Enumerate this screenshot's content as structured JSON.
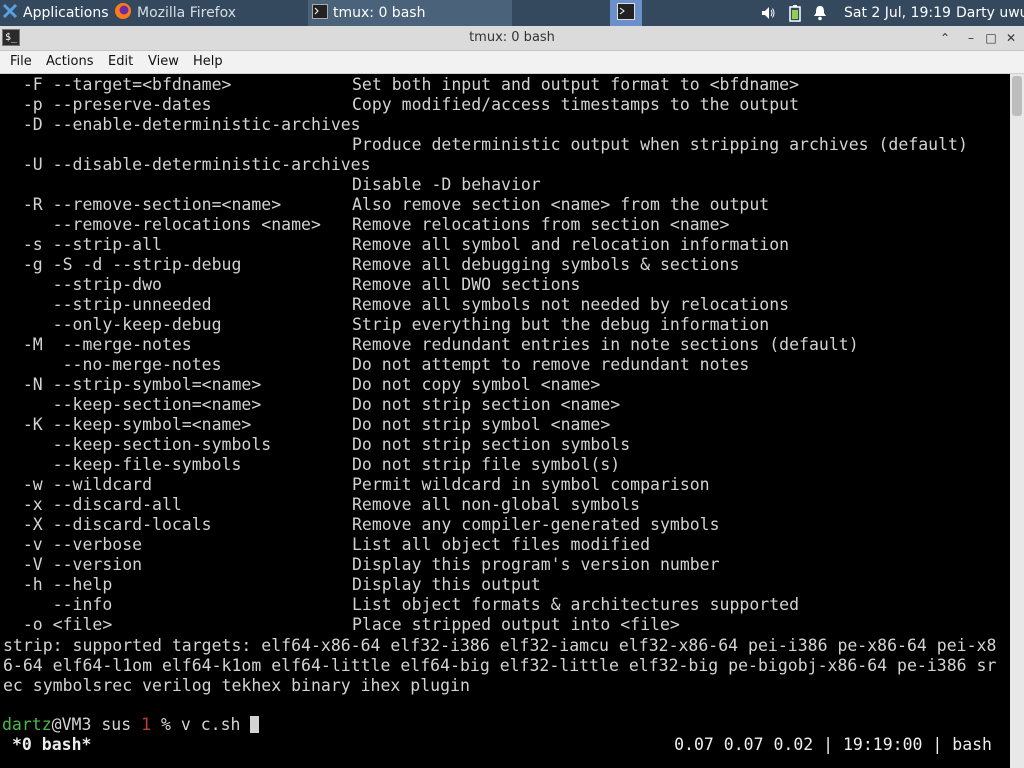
{
  "panel": {
    "applications_label": "Applications",
    "tasks": [
      {
        "label": "Mozilla Firefox"
      },
      {
        "label": "tmux: 0 bash"
      }
    ],
    "clock": "Sat  2 Jul, 19:19",
    "user": "Darty uwu"
  },
  "window": {
    "title": "tmux: 0 bash",
    "menu": [
      "File",
      "Actions",
      "Edit",
      "View",
      "Help"
    ]
  },
  "terminal": {
    "help_rows": [
      {
        "opt": "  -F --target=<bfdname>",
        "desc": "Set both input and output format to <bfdname>"
      },
      {
        "opt": "  -p --preserve-dates",
        "desc": "Copy modified/access timestamps to the output"
      },
      {
        "opt": "  -D --enable-deterministic-archives",
        "desc": ""
      },
      {
        "opt": "",
        "desc": "Produce deterministic output when stripping archives (default)"
      },
      {
        "opt": "  -U --disable-deterministic-archives",
        "desc": ""
      },
      {
        "opt": "",
        "desc": "Disable -D behavior"
      },
      {
        "opt": "  -R --remove-section=<name>",
        "desc": "Also remove section <name> from the output"
      },
      {
        "opt": "     --remove-relocations <name>",
        "desc": "Remove relocations from section <name>"
      },
      {
        "opt": "  -s --strip-all",
        "desc": "Remove all symbol and relocation information"
      },
      {
        "opt": "  -g -S -d --strip-debug",
        "desc": "Remove all debugging symbols & sections"
      },
      {
        "opt": "     --strip-dwo",
        "desc": "Remove all DWO sections"
      },
      {
        "opt": "     --strip-unneeded",
        "desc": "Remove all symbols not needed by relocations"
      },
      {
        "opt": "     --only-keep-debug",
        "desc": "Strip everything but the debug information"
      },
      {
        "opt": "  -M  --merge-notes",
        "desc": "Remove redundant entries in note sections (default)"
      },
      {
        "opt": "      --no-merge-notes",
        "desc": "Do not attempt to remove redundant notes"
      },
      {
        "opt": "  -N --strip-symbol=<name>",
        "desc": "Do not copy symbol <name>"
      },
      {
        "opt": "     --keep-section=<name>",
        "desc": "Do not strip section <name>"
      },
      {
        "opt": "  -K --keep-symbol=<name>",
        "desc": "Do not strip symbol <name>"
      },
      {
        "opt": "     --keep-section-symbols",
        "desc": "Do not strip section symbols"
      },
      {
        "opt": "     --keep-file-symbols",
        "desc": "Do not strip file symbol(s)"
      },
      {
        "opt": "  -w --wildcard",
        "desc": "Permit wildcard in symbol comparison"
      },
      {
        "opt": "  -x --discard-all",
        "desc": "Remove all non-global symbols"
      },
      {
        "opt": "  -X --discard-locals",
        "desc": "Remove any compiler-generated symbols"
      },
      {
        "opt": "  -v --verbose",
        "desc": "List all object files modified"
      },
      {
        "opt": "  -V --version",
        "desc": "Display this program's version number"
      },
      {
        "opt": "  -h --help",
        "desc": "Display this output"
      },
      {
        "opt": "     --info",
        "desc": "List object formats & architectures supported"
      },
      {
        "opt": "  -o <file>",
        "desc": "Place stripped output into <file>"
      }
    ],
    "targets_lines": [
      "strip: supported targets: elf64-x86-64 elf32-i386 elf32-iamcu elf32-x86-64 pei-i386 pe-x86-64 pei-x8",
      "6-64 elf64-l1om elf64-k1om elf64-little elf64-big elf32-little elf32-big pe-bigobj-x86-64 pe-i386 sr",
      "ec symbolsrec verilog tekhex binary ihex plugin"
    ],
    "prompt": {
      "user": "dartz",
      "host": "@VM3 sus ",
      "status": "1",
      "symbol": " % ",
      "command": "v c.sh "
    }
  },
  "tmux_status": {
    "window": "*0 bash*",
    "right": "0.07 0.07 0.02 | 19:19:00 | bash"
  },
  "colors": {
    "panel_bg": "#34495e",
    "prompt_user": "#4eb84e",
    "prompt_status": "#c23b3b",
    "terminal_fg": "#d3d3d3"
  }
}
